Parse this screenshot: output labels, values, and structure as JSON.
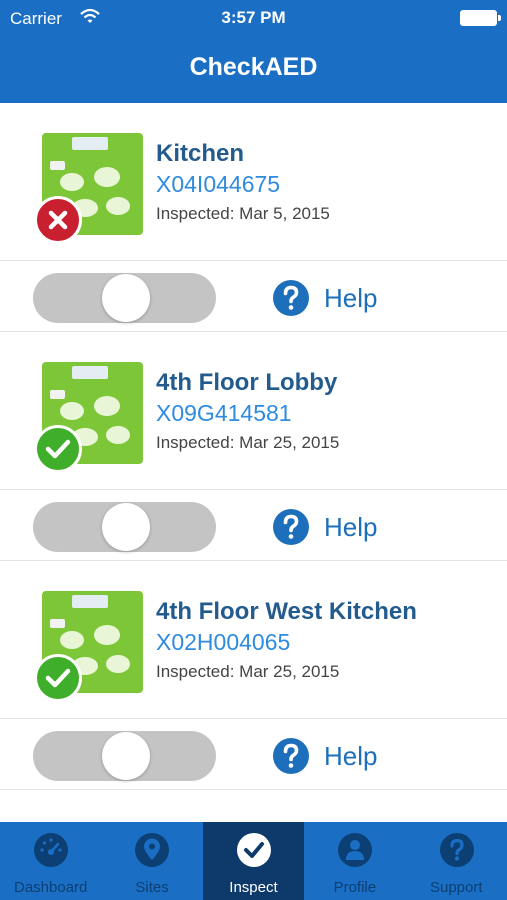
{
  "status_bar": {
    "carrier": "Carrier",
    "time": "3:57 PM"
  },
  "app": {
    "title": "CheckAED"
  },
  "aeds": [
    {
      "name": "Kitchen",
      "serial": "X04I044675",
      "inspected": "Inspected: Mar 5, 2015",
      "status": "fail"
    },
    {
      "name": "4th Floor Lobby",
      "serial": "X09G414581",
      "inspected": "Inspected: Mar 25, 2015",
      "status": "pass"
    },
    {
      "name": "4th Floor West Kitchen",
      "serial": "X02H004065",
      "inspected": "Inspected: Mar 25, 2015",
      "status": "pass"
    }
  ],
  "help_label": "Help",
  "tabs": [
    {
      "label": "Dashboard",
      "icon": "dashboard-icon",
      "active": false
    },
    {
      "label": "Sites",
      "icon": "location-pin-icon",
      "active": false
    },
    {
      "label": "Inspect",
      "icon": "checkmark-icon",
      "active": true
    },
    {
      "label": "Profile",
      "icon": "user-icon",
      "active": false
    },
    {
      "label": "Support",
      "icon": "question-icon",
      "active": false
    }
  ],
  "colors": {
    "brand_blue": "#1a6fc4",
    "active_tab": "#0d3a6a",
    "fail_red": "#c8202e",
    "pass_green": "#3fae2a",
    "serial_blue": "#2f8be0"
  }
}
